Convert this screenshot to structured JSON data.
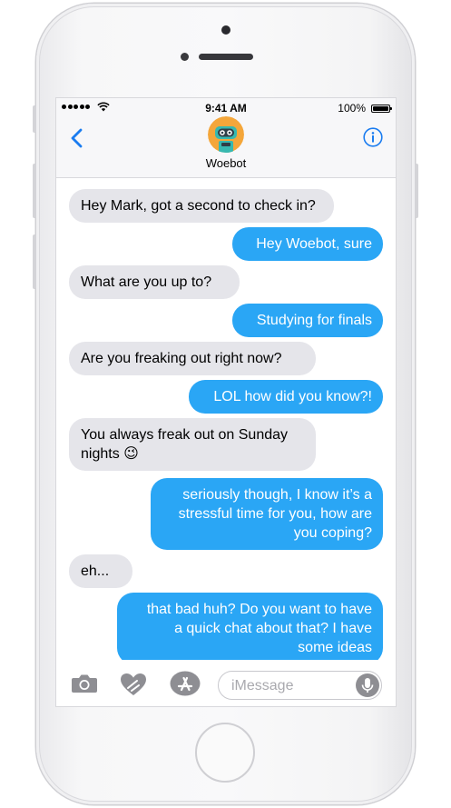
{
  "status_bar": {
    "time": "9:41 AM",
    "battery": "100%"
  },
  "header": {
    "contact_name": "Woebot"
  },
  "messages": [
    {
      "from": "bot",
      "text": "Hey Mark, got a second to check in?"
    },
    {
      "from": "user",
      "text": "Hey Woebot, sure"
    },
    {
      "from": "bot",
      "text": "What are you up to?"
    },
    {
      "from": "user",
      "text": "Studying for finals"
    },
    {
      "from": "bot",
      "text": "Are you freaking out right now?"
    },
    {
      "from": "user",
      "text": "LOL how did you know?!"
    },
    {
      "from": "bot",
      "text": "You always freak out on Sunday\nnights 😉"
    },
    {
      "from": "user",
      "text": "seriously though, I know it’s a\nstressful time for you, how are\nyou coping?"
    },
    {
      "from": "bot",
      "text": "eh..."
    },
    {
      "from": "user",
      "text": "that bad huh? Do you want to have\na quick chat about that? I have\nsome ideas"
    }
  ],
  "composer": {
    "placeholder": "iMessage"
  },
  "colors": {
    "outgoing": "#2aa6f5",
    "incoming": "#e5e5ea",
    "accent": "#1a7cf0"
  },
  "icons": [
    "back-chevron-icon",
    "info-icon",
    "camera-icon",
    "digital-touch-heart-icon",
    "app-store-icon",
    "microphone-icon"
  ]
}
